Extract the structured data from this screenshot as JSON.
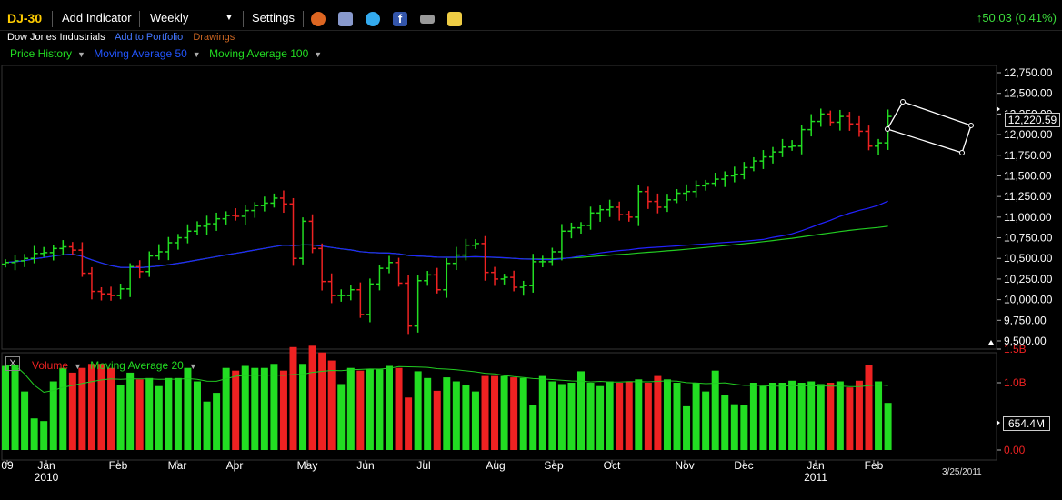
{
  "toolbar": {
    "symbol": "DJ-30",
    "add_indicator": "Add Indicator",
    "period": "Weekly",
    "settings": "Settings",
    "change": "50.03 (0.41%)",
    "icons": [
      "alarm-clock-icon",
      "copy-icon",
      "twitter-icon",
      "facebook-icon",
      "camera-icon",
      "note-icon"
    ]
  },
  "subheader": {
    "name": "Dow Jones Industrials",
    "add_to_portfolio": "Add to Portfolio",
    "drawings": "Drawings"
  },
  "legend": {
    "price_history": "Price History",
    "ma50": "Moving Average 50",
    "ma100": "Moving Average 100"
  },
  "price_axis": {
    "ticks": [
      "12,750.00",
      "12,500.00",
      "12,250.00",
      "12,000.00",
      "11,750.00",
      "11,500.00",
      "11,250.00",
      "11,000.00",
      "10,750.00",
      "10,500.00",
      "10,250.00",
      "10,000.00",
      "9,750.00",
      "9,500.00"
    ],
    "current_label": "12,220.59"
  },
  "volume_panel": {
    "volume_label": "Volume",
    "ma_label": "Moving Average 20",
    "ticks": [
      "1.5B",
      "1.0B",
      "0.00"
    ],
    "current_label": "654.4M"
  },
  "x_axis": {
    "months": [
      {
        "label": "09",
        "year": ""
      },
      {
        "label": "Jan",
        "year": "2010"
      },
      {
        "label": "Feb",
        "year": ""
      },
      {
        "label": "Mar",
        "year": ""
      },
      {
        "label": "Apr",
        "year": ""
      },
      {
        "label": "May",
        "year": ""
      },
      {
        "label": "Jun",
        "year": ""
      },
      {
        "label": "Jul",
        "year": ""
      },
      {
        "label": "Aug",
        "year": ""
      },
      {
        "label": "Sep",
        "year": ""
      },
      {
        "label": "Oct",
        "year": ""
      },
      {
        "label": "Nov",
        "year": ""
      },
      {
        "label": "Dec",
        "year": ""
      },
      {
        "label": "Jan",
        "year": "2011"
      },
      {
        "label": "Feb",
        "year": ""
      }
    ],
    "date_stamp": "3/25/2011"
  },
  "colors": {
    "up": "#22dd22",
    "down": "#ee2222",
    "ma50": "#2222ff",
    "ma100": "#22cc22",
    "symbol": "#ffcc00"
  },
  "chart_data": {
    "type": "ohlc",
    "period": "weekly",
    "price_range": [
      9500,
      12750
    ],
    "closes": [
      10450,
      10470,
      10500,
      10560,
      10570,
      10620,
      10640,
      10600,
      10320,
      10100,
      10070,
      10050,
      10130,
      10400,
      10340,
      10530,
      10580,
      10690,
      10750,
      10830,
      10890,
      10920,
      10980,
      11020,
      11010,
      11080,
      11140,
      11170,
      11230,
      11160,
      10500,
      10950,
      10620,
      10220,
      10050,
      10050,
      10120,
      9820,
      10190,
      10380,
      10450,
      10200,
      9680,
      10230,
      10300,
      10120,
      10440,
      10540,
      10660,
      10680,
      10330,
      10250,
      10270,
      10150,
      10170,
      10460,
      10460,
      10580,
      10830,
      10870,
      10900,
      11050,
      11090,
      11120,
      11030,
      11000,
      11310,
      11190,
      11120,
      11210,
      11290,
      11310,
      11380,
      11410,
      11460,
      11500,
      11520,
      11600,
      11680,
      11730,
      11790,
      11850,
      11860,
      12060,
      12160,
      12250,
      12150,
      12220,
      12130,
      12040,
      11860,
      11900,
      12220
    ],
    "volume_ma20_approx": 1.0,
    "volumes_billions": [
      1.25,
      1.27,
      0.87,
      0.47,
      0.43,
      1.02,
      1.22,
      1.15,
      1.22,
      1.28,
      1.28,
      1.22,
      0.97,
      1.15,
      1.05,
      1.07,
      0.95,
      1.07,
      1.07,
      1.22,
      1.02,
      0.72,
      0.85,
      1.22,
      1.18,
      1.25,
      1.22,
      1.22,
      1.28,
      1.18,
      1.53,
      1.28,
      1.55,
      1.45,
      1.33,
      0.98,
      1.22,
      1.18,
      1.2,
      1.2,
      1.25,
      1.22,
      0.78,
      1.17,
      1.07,
      0.88,
      1.08,
      1.02,
      0.97,
      0.87,
      1.1,
      1.1,
      1.1,
      1.08,
      1.07,
      0.67,
      1.1,
      1.02,
      0.98,
      1.0,
      1.17,
      1.0,
      0.95,
      1.02,
      1.0,
      1.02,
      1.05,
      1.0,
      1.1,
      1.05,
      1.0,
      0.65,
      1.0,
      0.87,
      1.18,
      0.82,
      0.68,
      0.67,
      1.0,
      0.95,
      1.0,
      1.0,
      1.03,
      1.0,
      1.02,
      0.98,
      1.0,
      1.02,
      0.93,
      1.03,
      1.27,
      1.02,
      0.7
    ]
  }
}
